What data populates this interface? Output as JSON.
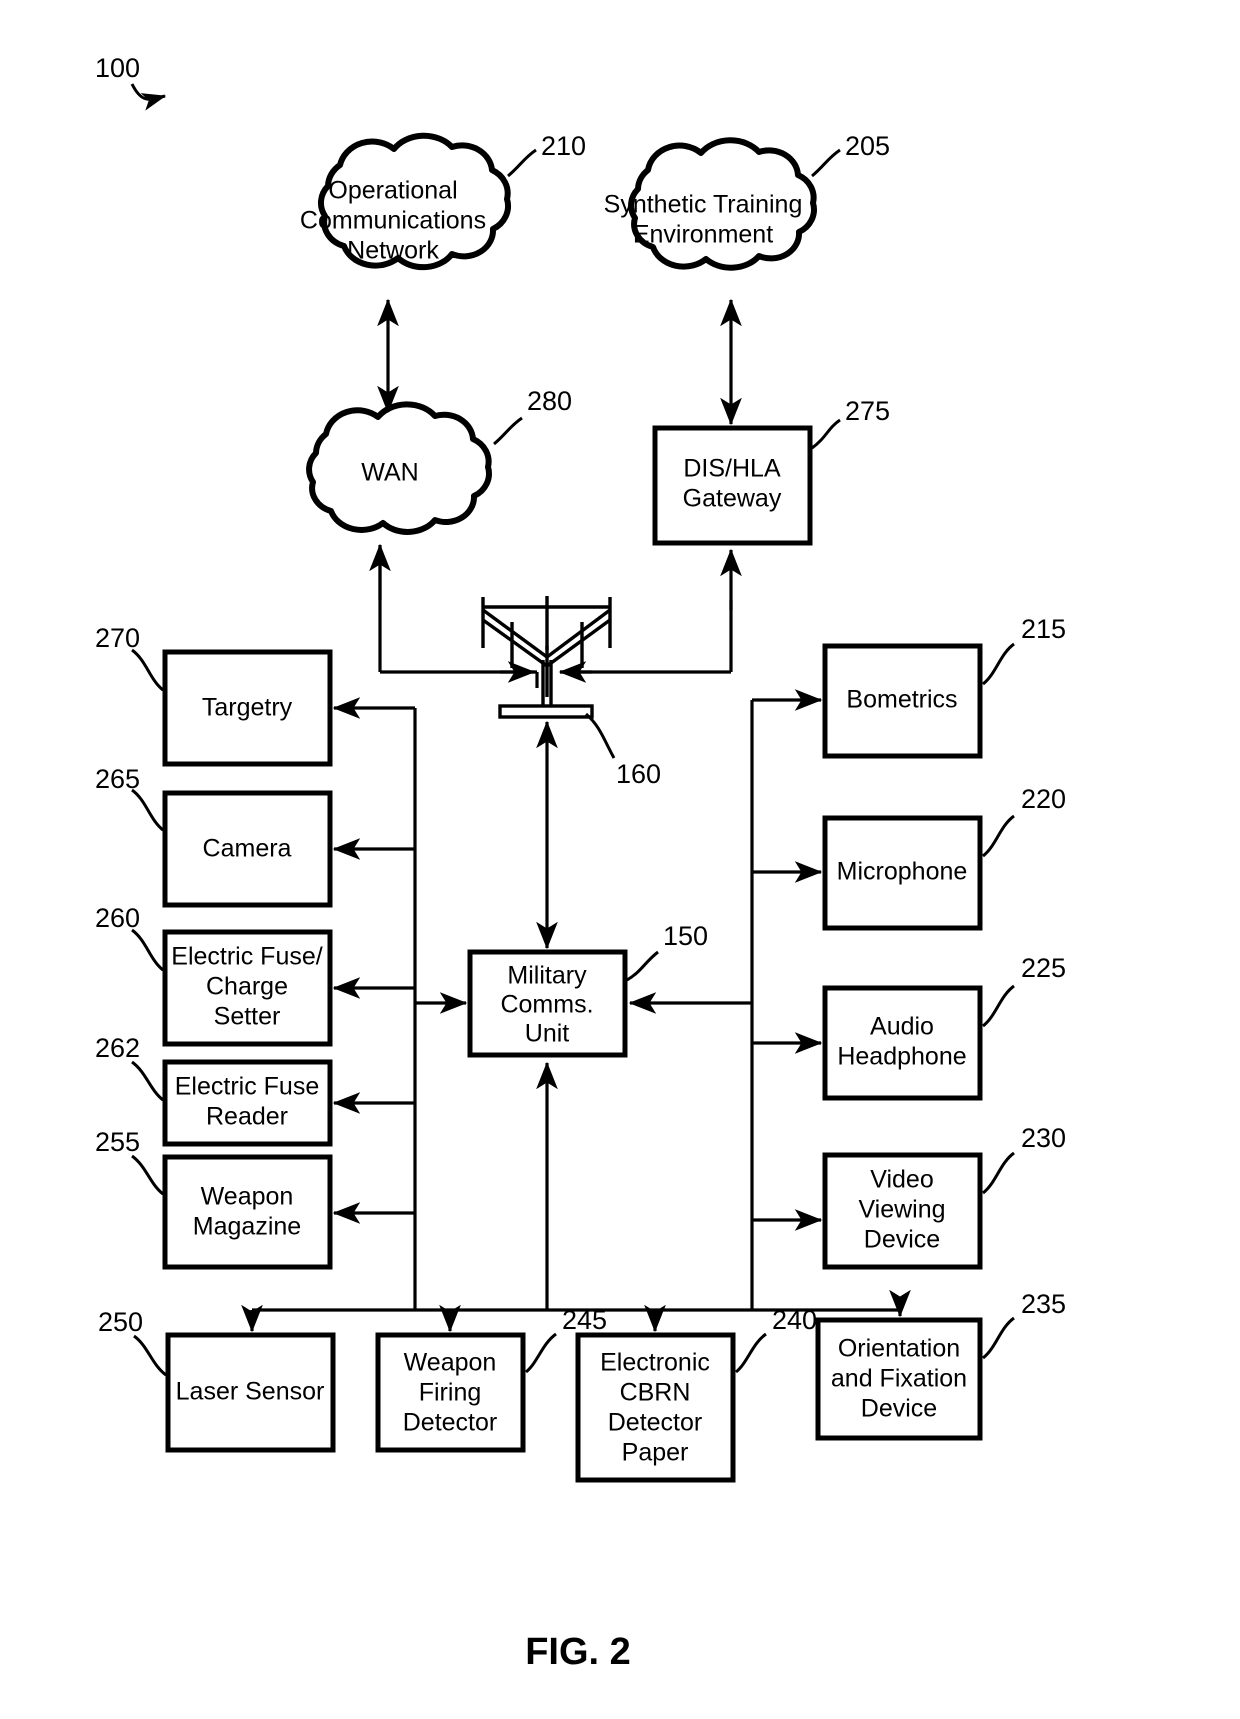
{
  "figure": {
    "caption": "FIG. 2",
    "system_ref": "100"
  },
  "clouds": [
    {
      "id": "operational-communications-network",
      "ref": "210",
      "lines": [
        "Operational",
        "Communications",
        "Network"
      ]
    },
    {
      "id": "synthetic-training-environment",
      "ref": "205",
      "lines": [
        "Synthetic Training",
        "Environment"
      ]
    },
    {
      "id": "wan",
      "ref": "280",
      "lines": [
        "WAN"
      ]
    }
  ],
  "boxes": {
    "dis_hla_gateway": {
      "ref": "275",
      "lines": [
        "DIS/HLA",
        "Gateway"
      ]
    },
    "military_comms_unit": {
      "ref": "150",
      "lines": [
        "Military",
        "Comms.",
        "Unit"
      ]
    },
    "antenna": {
      "ref": "160",
      "lines": []
    },
    "targetry": {
      "ref": "270",
      "lines": [
        "Targetry"
      ]
    },
    "camera": {
      "ref": "265",
      "lines": [
        "Camera"
      ]
    },
    "electric_fuse_charge_setter": {
      "ref": "260",
      "lines": [
        "Electric Fuse/",
        "Charge",
        "Setter"
      ]
    },
    "electric_fuse_reader": {
      "ref": "262",
      "lines": [
        "Electric Fuse",
        "Reader"
      ]
    },
    "weapon_magazine": {
      "ref": "255",
      "lines": [
        "Weapon",
        "Magazine"
      ]
    },
    "bometrics": {
      "ref": "215",
      "lines": [
        "Bometrics"
      ]
    },
    "microphone": {
      "ref": "220",
      "lines": [
        "Microphone"
      ]
    },
    "audio_headphone": {
      "ref": "225",
      "lines": [
        "Audio",
        "Headphone"
      ]
    },
    "video_viewing_device": {
      "ref": "230",
      "lines": [
        "Video",
        "Viewing",
        "Device"
      ]
    },
    "laser_sensor": {
      "ref": "250",
      "lines": [
        "Laser Sensor"
      ]
    },
    "weapon_firing_detector": {
      "ref": "245",
      "lines": [
        "Weapon",
        "Firing",
        "Detector"
      ]
    },
    "electronic_cbrn_detector_paper": {
      "ref": "240",
      "lines": [
        "Electronic",
        "CBRN",
        "Detector",
        "Paper"
      ]
    },
    "orientation_and_fixation_device": {
      "ref": "235",
      "lines": [
        "Orientation",
        "and Fixation",
        "Device"
      ]
    }
  },
  "colors": {
    "ink": "#000000",
    "paper": "#ffffff"
  }
}
